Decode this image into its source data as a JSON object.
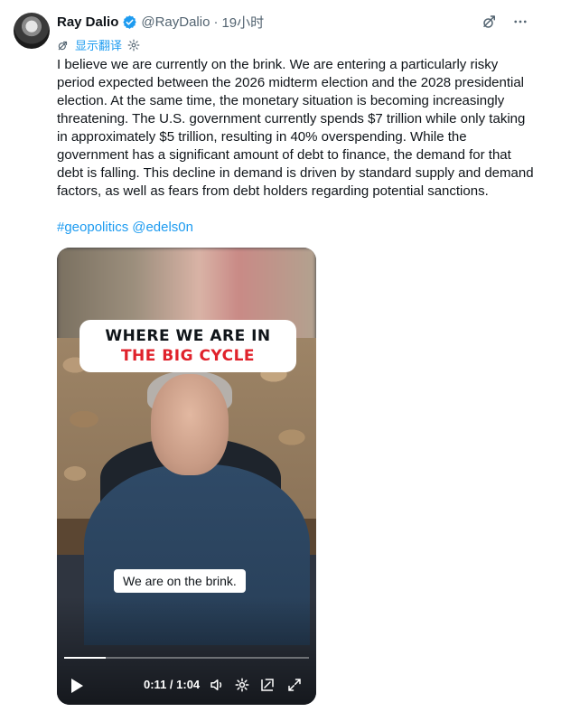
{
  "author": {
    "name": "Ray Dalio",
    "handle": "@RayDalio",
    "separator": "·",
    "time": "19小时"
  },
  "translate": {
    "label": "显示翻译"
  },
  "tweet": {
    "text": "I believe we are currently on the brink. We are entering a particularly risky period expected between the 2026 midterm election and the 2028 presidential election. At the same time, the monetary situation is becoming increasingly threatening. The U.S. government currently spends $7 trillion while only taking in approximately $5 trillion, resulting in 40% overspending. While the government has a significant amount of debt to finance, the demand for that debt is falling. This decline in demand is driven by standard supply and demand factors, as well as fears from debt holders regarding potential sanctions.",
    "hashtag": "#geopolitics",
    "mention": "@edels0n"
  },
  "video": {
    "title_line1": "WHERE WE ARE IN",
    "title_line2": "THE BIG CYCLE",
    "caption": "We are on the brink.",
    "time_readout": "0:11 / 1:04",
    "progress": 0.17
  },
  "colors": {
    "accent": "#1d9bf0",
    "title_red": "#e0222b"
  },
  "icons": {
    "verified": "verified-badge-icon",
    "grok": "grok-icon",
    "more": "more-icon",
    "translate": "translate-icon",
    "settings": "gear-icon",
    "play": "play-icon",
    "volume": "volume-icon",
    "dock": "dock-icon",
    "fullscreen": "fullscreen-icon"
  }
}
